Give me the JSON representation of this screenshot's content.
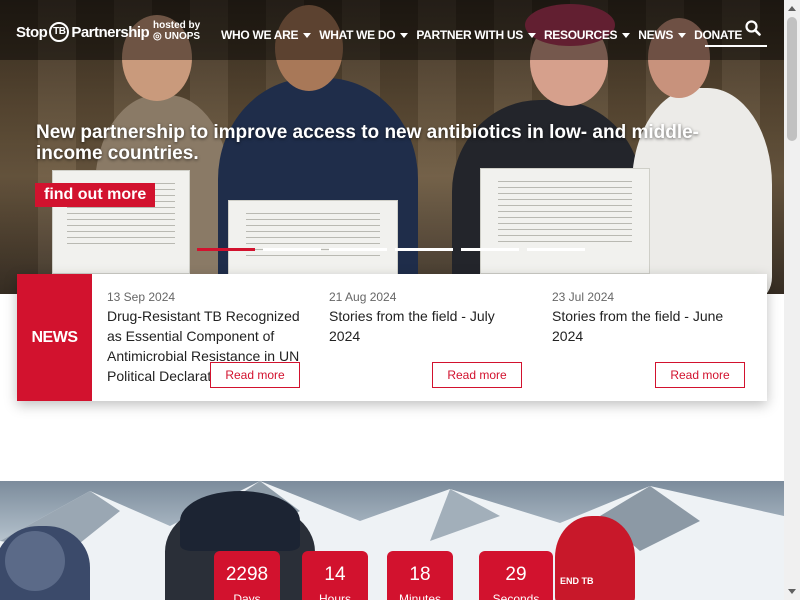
{
  "header": {
    "logo_left": "Stop",
    "logo_tb": "TB",
    "logo_right": "Partnership",
    "hosted_line1": "hosted by",
    "hosted_line2": "UNOPS"
  },
  "nav": {
    "items": [
      {
        "label": "WHO WE ARE",
        "dropdown": true
      },
      {
        "label": "WHAT WE DO",
        "dropdown": true
      },
      {
        "label": "PARTNER WITH US",
        "dropdown": true
      },
      {
        "label": "RESOURCES",
        "dropdown": true
      },
      {
        "label": "NEWS",
        "dropdown": true
      },
      {
        "label": "DONATE",
        "dropdown": false
      }
    ],
    "search_icon": "search-icon"
  },
  "hero": {
    "headline": "New partnership to improve access to new antibiotics in low- and middle-income countries.",
    "cta_label": "find out more",
    "slides_count": 6,
    "active_slide": 1
  },
  "news": {
    "tag": "NEWS",
    "items": [
      {
        "date": "13 Sep 2024",
        "title": "Drug-Resistant TB Recognized as Essential Component of Antimicrobial Resistance in UN Political Declaration",
        "button": "Read more"
      },
      {
        "date": "21 Aug 2024",
        "title": "Stories from the field - July 2024",
        "button": "Read more"
      },
      {
        "date": "23 Jul 2024",
        "title": "Stories from the field - June 2024",
        "button": "Read more"
      }
    ]
  },
  "countdown": [
    {
      "value": "2298",
      "label": "Days"
    },
    {
      "value": "14",
      "label": "Hours"
    },
    {
      "value": "18",
      "label": "Minutes"
    },
    {
      "value": "29",
      "label": "Seconds"
    }
  ],
  "lower_image": {
    "banner_text": "END TB"
  },
  "colors": {
    "brand_red": "#d2122e",
    "white": "#ffffff"
  }
}
